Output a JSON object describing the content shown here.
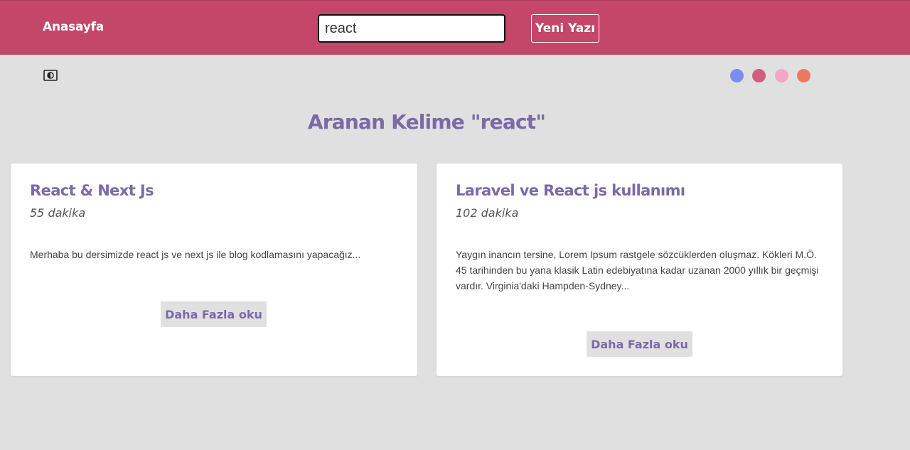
{
  "nav": {
    "home_label": "Anasayfa",
    "search_value": "react",
    "new_post_label": "Yeni Yazı"
  },
  "theme": {
    "toggle_icon": "contrast-toggle-icon",
    "colors": [
      "#7b8ef0",
      "#cd5e7e",
      "#f4a7c4",
      "#e87b5f"
    ]
  },
  "search": {
    "heading": "Aranan Kelime \"react\""
  },
  "posts": [
    {
      "title": "React & Next Js",
      "duration": "55 dakika",
      "excerpt": "Merhaba bu dersimizde react js ve next js ile blog kodlamasını yapacağız...",
      "button_label": "Daha Fazla oku"
    },
    {
      "title": "Laravel ve React js kullanımı",
      "duration": "102 dakika",
      "excerpt": "Yaygın inancın tersine, Lorem Ipsum rastgele sözcüklerden oluşmaz. Kökleri M.Ö. 45 tarihinden bu yana klasik Latin edebiyatına kadar uzanan 2000 yıllık bir geçmişi vardır. Virginia'daki Hampden-Sydney...",
      "button_label": "Daha Fazla oku"
    }
  ]
}
